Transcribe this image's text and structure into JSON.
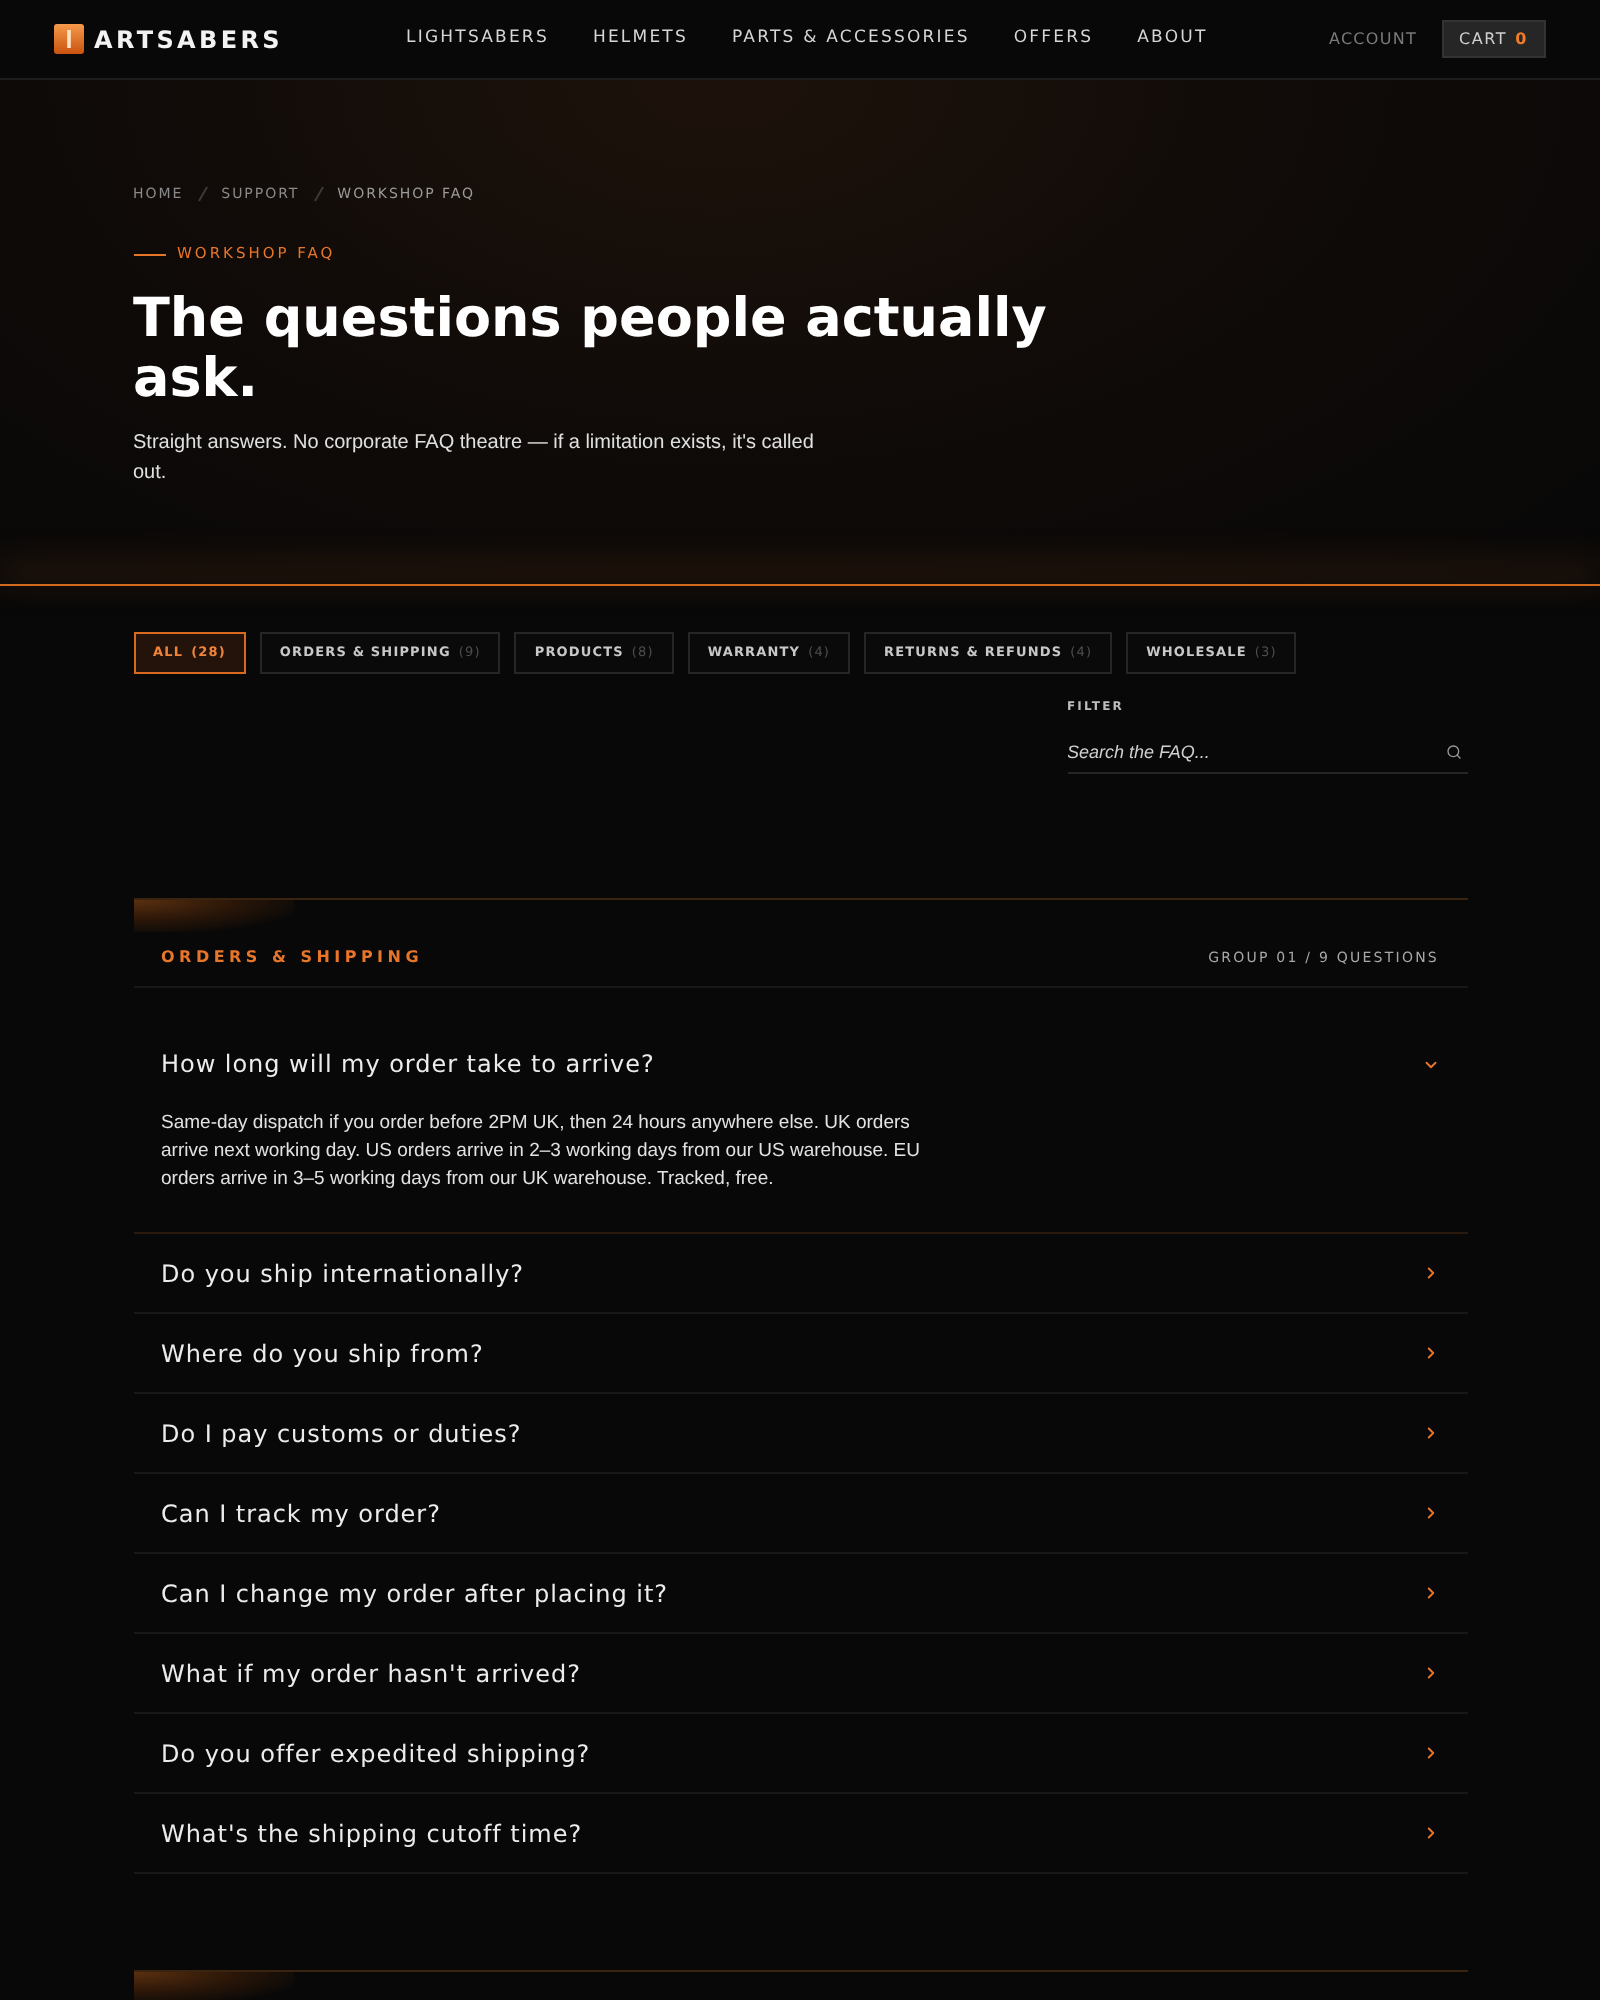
{
  "header": {
    "logo": "ARTSABERS",
    "nav": [
      {
        "label": "LIGHTSABERS"
      },
      {
        "label": "HELMETS"
      },
      {
        "label": "PARTS & ACCESSORIES"
      },
      {
        "label": "OFFERS"
      },
      {
        "label": "ABOUT"
      }
    ],
    "account": "ACCOUNT",
    "cart": {
      "label": "CART",
      "count": "0"
    }
  },
  "hero": {
    "breadcrumbs": [
      "HOME",
      "SUPPORT",
      "WORKSHOP FAQ"
    ],
    "eyebrow": "WORKSHOP FAQ",
    "title": "The questions people actually ask.",
    "subtitle": "Straight answers. No corporate FAQ theatre — if a limitation exists, it's called out."
  },
  "filters": {
    "tabs": [
      {
        "label": "ALL",
        "count": "(28)",
        "selected": true
      },
      {
        "label": "ORDERS & SHIPPING",
        "count": "(9)",
        "selected": false
      },
      {
        "label": "PRODUCTS",
        "count": "(8)",
        "selected": false
      },
      {
        "label": "WARRANTY",
        "count": "(4)",
        "selected": false
      },
      {
        "label": "RETURNS & REFUNDS",
        "count": "(4)",
        "selected": false
      },
      {
        "label": "WHOLESALE",
        "count": "(3)",
        "selected": false
      }
    ],
    "filter_label": "FILTER",
    "search": {
      "placeholder": "Search the FAQ..."
    }
  },
  "groups": [
    {
      "title": "ORDERS & SHIPPING",
      "meta": "GROUP 01 / 9 QUESTIONS",
      "questions": [
        {
          "question": "How long will my order take to arrive?",
          "expanded": true,
          "answer": "Same-day dispatch if you order before 2PM UK, then 24 hours anywhere else. UK orders arrive next working day. US orders arrive in 2–3 working days from our US warehouse. EU orders arrive in 3–5 working days from our UK warehouse. Tracked, free."
        },
        {
          "question": "Do you ship internationally?",
          "expanded": false
        },
        {
          "question": "Where do you ship from?",
          "expanded": false
        },
        {
          "question": "Do I pay customs or duties?",
          "expanded": false
        },
        {
          "question": "Can I track my order?",
          "expanded": false
        },
        {
          "question": "Can I change my order after placing it?",
          "expanded": false
        },
        {
          "question": "What if my order hasn't arrived?",
          "expanded": false
        },
        {
          "question": "Do you offer expedited shipping?",
          "expanded": false
        },
        {
          "question": "What's the shipping cutoff time?",
          "expanded": false
        }
      ]
    }
  ]
}
